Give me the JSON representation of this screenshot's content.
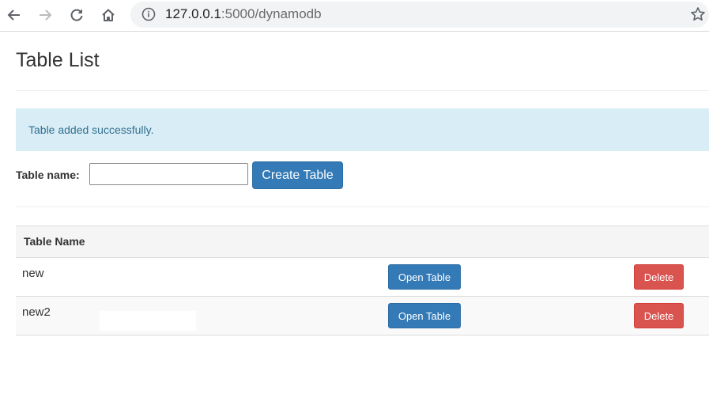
{
  "browser": {
    "url_host": "127.0.0.1",
    "url_path": ":5000/dynamodb"
  },
  "page": {
    "title": "Table List",
    "alert": "Table added successfully.",
    "form": {
      "label": "Table name:",
      "input_value": "",
      "create_button": "Create Table"
    },
    "table": {
      "header": "Table Name",
      "rows": [
        {
          "name": "new",
          "open_label": "Open Table",
          "delete_label": "Delete"
        },
        {
          "name": "new2",
          "open_label": "Open Table",
          "delete_label": "Delete"
        }
      ]
    }
  },
  "colors": {
    "primary": "#337ab7",
    "danger": "#d9534f",
    "info_bg": "#d9edf7"
  },
  "icons": [
    "back-icon",
    "forward-icon",
    "reload-icon",
    "home-icon",
    "info-icon",
    "star-icon"
  ]
}
